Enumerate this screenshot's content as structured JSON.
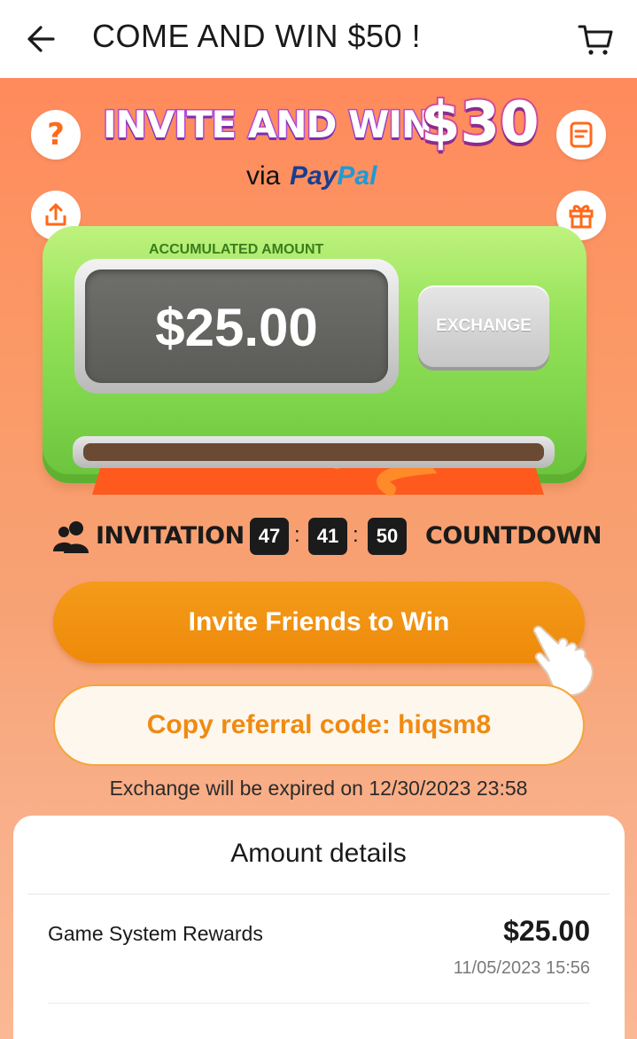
{
  "header": {
    "title": "COME AND WIN $50 !",
    "back_icon": "arrow-left-icon",
    "cart_icon": "cart-icon"
  },
  "banner": {
    "headline": "INVITE AND WIN",
    "amount": "$30",
    "via": "via",
    "paypal_pay": "Pay",
    "paypal_pal": "Pal"
  },
  "side_buttons": {
    "help_glyph": "?",
    "help_icon": "question-icon",
    "rules_icon": "document-icon",
    "share_icon": "share-icon",
    "gift_icon": "gift-icon"
  },
  "machine": {
    "label": "ACCUMULATED AMOUNT",
    "amount": "$25.00",
    "exchange_label": "EXCHANGE"
  },
  "countdown": {
    "left_label": "INVITATION",
    "right_label": "COUNTDOWN",
    "hours": "47",
    "minutes": "41",
    "seconds": "50",
    "separator": ":"
  },
  "actions": {
    "invite_label": "Invite Friends to Win",
    "copy_label": "Copy referral code: hiqsm8",
    "expire_note": "Exchange will be expired on 12/30/2023 23:58"
  },
  "details": {
    "title": "Amount details",
    "rows": [
      {
        "label": "Game System Rewards",
        "amount": "$25.00",
        "date": "11/05/2023 15:56"
      }
    ]
  },
  "colors": {
    "accent_orange": "#ee8a0a",
    "background_orange": "#f6a06f",
    "machine_green": "#96e35a",
    "paypal_blue": "#1a3d8f",
    "paypal_light_blue": "#1e9ad6"
  }
}
